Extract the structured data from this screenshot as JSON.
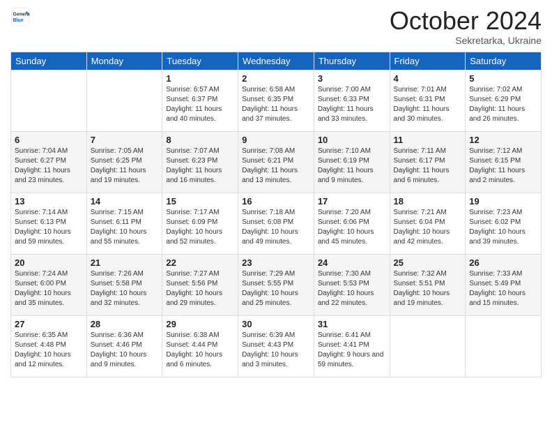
{
  "header": {
    "logo": {
      "general": "General",
      "blue": "Blue"
    },
    "title": "October 2024",
    "subtitle": "Sekretarka, Ukraine"
  },
  "days_of_week": [
    "Sunday",
    "Monday",
    "Tuesday",
    "Wednesday",
    "Thursday",
    "Friday",
    "Saturday"
  ],
  "weeks": [
    [
      {
        "day": "",
        "info": ""
      },
      {
        "day": "",
        "info": ""
      },
      {
        "day": "1",
        "info": "Sunrise: 6:57 AM\nSunset: 6:37 PM\nDaylight: 11 hours and 40 minutes."
      },
      {
        "day": "2",
        "info": "Sunrise: 6:58 AM\nSunset: 6:35 PM\nDaylight: 11 hours and 37 minutes."
      },
      {
        "day": "3",
        "info": "Sunrise: 7:00 AM\nSunset: 6:33 PM\nDaylight: 11 hours and 33 minutes."
      },
      {
        "day": "4",
        "info": "Sunrise: 7:01 AM\nSunset: 6:31 PM\nDaylight: 11 hours and 30 minutes."
      },
      {
        "day": "5",
        "info": "Sunrise: 7:02 AM\nSunset: 6:29 PM\nDaylight: 11 hours and 26 minutes."
      }
    ],
    [
      {
        "day": "6",
        "info": "Sunrise: 7:04 AM\nSunset: 6:27 PM\nDaylight: 11 hours and 23 minutes."
      },
      {
        "day": "7",
        "info": "Sunrise: 7:05 AM\nSunset: 6:25 PM\nDaylight: 11 hours and 19 minutes."
      },
      {
        "day": "8",
        "info": "Sunrise: 7:07 AM\nSunset: 6:23 PM\nDaylight: 11 hours and 16 minutes."
      },
      {
        "day": "9",
        "info": "Sunrise: 7:08 AM\nSunset: 6:21 PM\nDaylight: 11 hours and 13 minutes."
      },
      {
        "day": "10",
        "info": "Sunrise: 7:10 AM\nSunset: 6:19 PM\nDaylight: 11 hours and 9 minutes."
      },
      {
        "day": "11",
        "info": "Sunrise: 7:11 AM\nSunset: 6:17 PM\nDaylight: 11 hours and 6 minutes."
      },
      {
        "day": "12",
        "info": "Sunrise: 7:12 AM\nSunset: 6:15 PM\nDaylight: 11 hours and 2 minutes."
      }
    ],
    [
      {
        "day": "13",
        "info": "Sunrise: 7:14 AM\nSunset: 6:13 PM\nDaylight: 10 hours and 59 minutes."
      },
      {
        "day": "14",
        "info": "Sunrise: 7:15 AM\nSunset: 6:11 PM\nDaylight: 10 hours and 55 minutes."
      },
      {
        "day": "15",
        "info": "Sunrise: 7:17 AM\nSunset: 6:09 PM\nDaylight: 10 hours and 52 minutes."
      },
      {
        "day": "16",
        "info": "Sunrise: 7:18 AM\nSunset: 6:08 PM\nDaylight: 10 hours and 49 minutes."
      },
      {
        "day": "17",
        "info": "Sunrise: 7:20 AM\nSunset: 6:06 PM\nDaylight: 10 hours and 45 minutes."
      },
      {
        "day": "18",
        "info": "Sunrise: 7:21 AM\nSunset: 6:04 PM\nDaylight: 10 hours and 42 minutes."
      },
      {
        "day": "19",
        "info": "Sunrise: 7:23 AM\nSunset: 6:02 PM\nDaylight: 10 hours and 39 minutes."
      }
    ],
    [
      {
        "day": "20",
        "info": "Sunrise: 7:24 AM\nSunset: 6:00 PM\nDaylight: 10 hours and 35 minutes."
      },
      {
        "day": "21",
        "info": "Sunrise: 7:26 AM\nSunset: 5:58 PM\nDaylight: 10 hours and 32 minutes."
      },
      {
        "day": "22",
        "info": "Sunrise: 7:27 AM\nSunset: 5:56 PM\nDaylight: 10 hours and 29 minutes."
      },
      {
        "day": "23",
        "info": "Sunrise: 7:29 AM\nSunset: 5:55 PM\nDaylight: 10 hours and 25 minutes."
      },
      {
        "day": "24",
        "info": "Sunrise: 7:30 AM\nSunset: 5:53 PM\nDaylight: 10 hours and 22 minutes."
      },
      {
        "day": "25",
        "info": "Sunrise: 7:32 AM\nSunset: 5:51 PM\nDaylight: 10 hours and 19 minutes."
      },
      {
        "day": "26",
        "info": "Sunrise: 7:33 AM\nSunset: 5:49 PM\nDaylight: 10 hours and 15 minutes."
      }
    ],
    [
      {
        "day": "27",
        "info": "Sunrise: 6:35 AM\nSunset: 4:48 PM\nDaylight: 10 hours and 12 minutes."
      },
      {
        "day": "28",
        "info": "Sunrise: 6:36 AM\nSunset: 4:46 PM\nDaylight: 10 hours and 9 minutes."
      },
      {
        "day": "29",
        "info": "Sunrise: 6:38 AM\nSunset: 4:44 PM\nDaylight: 10 hours and 6 minutes."
      },
      {
        "day": "30",
        "info": "Sunrise: 6:39 AM\nSunset: 4:43 PM\nDaylight: 10 hours and 3 minutes."
      },
      {
        "day": "31",
        "info": "Sunrise: 6:41 AM\nSunset: 4:41 PM\nDaylight: 9 hours and 59 minutes."
      },
      {
        "day": "",
        "info": ""
      },
      {
        "day": "",
        "info": ""
      }
    ]
  ]
}
